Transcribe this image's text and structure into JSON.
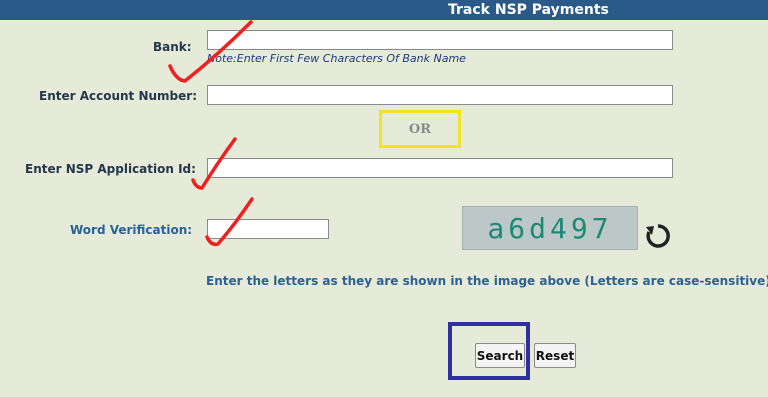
{
  "header": {
    "title": "Track NSP Payments"
  },
  "form": {
    "bank": {
      "label": "Bank:",
      "value": "",
      "note": "Note:Enter First Few Characters Of Bank Name"
    },
    "account_number": {
      "label": "Enter Account Number:",
      "value": ""
    },
    "separator": {
      "label": "OR"
    },
    "application_id": {
      "label": "Enter NSP Application Id:",
      "value": ""
    },
    "word_verification": {
      "label": "Word Verification:",
      "value": ""
    },
    "captcha": {
      "text": "a6d497"
    },
    "instruction": "Enter the letters as they are shown in the image above (Letters are case-sensitive).",
    "buttons": {
      "search": "Search",
      "reset": "Reset"
    }
  },
  "annotations": {
    "check_color": "#ef2020",
    "or_highlight_color": "#f0e420",
    "search_highlight_color": "#2d2fa3"
  },
  "icons": {
    "refresh": "refresh-icon"
  }
}
